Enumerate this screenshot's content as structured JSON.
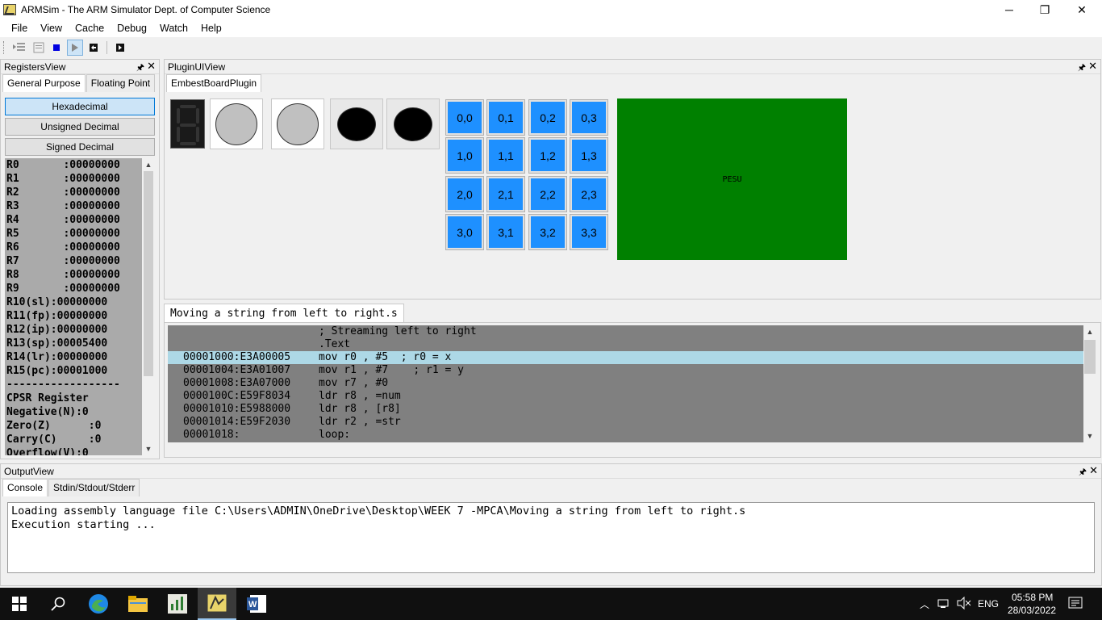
{
  "window": {
    "title": "ARMSim - The ARM Simulator Dept. of Computer Science",
    "minimize": "─",
    "restore": "❐",
    "close": "✕"
  },
  "menu": [
    "File",
    "View",
    "Cache",
    "Debug",
    "Watch",
    "Help"
  ],
  "registers_view": {
    "title": "RegistersView",
    "tabs": [
      "General Purpose",
      "Floating Point"
    ],
    "formats": [
      "Hexadecimal",
      "Unsigned Decimal",
      "Signed Decimal"
    ],
    "selected_format": "Hexadecimal",
    "lines": [
      "R0       :00000000",
      "R1       :00000000",
      "R2       :00000000",
      "R3       :00000000",
      "R4       :00000000",
      "R5       :00000000",
      "R6       :00000000",
      "R7       :00000000",
      "R8       :00000000",
      "R9       :00000000",
      "R10(sl):00000000",
      "R11(fp):00000000",
      "R12(ip):00000000",
      "R13(sp):00005400",
      "R14(lr):00000000",
      "R15(pc):00001000",
      "------------------",
      "CPSR Register",
      "Negative(N):0",
      "Zero(Z)      :0",
      "Carry(C)     :0",
      "Overflow(V):0"
    ]
  },
  "plugin_view": {
    "title": "PluginUIView",
    "tab": "EmbestBoardPlugin",
    "leds": [
      {
        "state": "off",
        "color": "#c0c0c0"
      },
      {
        "state": "off",
        "color": "#c0c0c0"
      },
      {
        "state": "on",
        "color": "#000000"
      },
      {
        "state": "on",
        "color": "#000000"
      }
    ],
    "keypad": [
      [
        "0,0",
        "0,1",
        "0,2",
        "0,3"
      ],
      [
        "1,0",
        "1,1",
        "1,2",
        "1,3"
      ],
      [
        "2,0",
        "2,1",
        "2,2",
        "2,3"
      ],
      [
        "3,0",
        "3,1",
        "3,2",
        "3,3"
      ]
    ],
    "keypad_color": "#1e90ff",
    "lcd_text": "PESU",
    "lcd_color": "#008000"
  },
  "code_view": {
    "tab": "Moving a string from left to right.s",
    "lines": [
      {
        "addr": "",
        "src": "; Streaming left to right",
        "highlight": false
      },
      {
        "addr": "",
        "src": ".Text",
        "highlight": false
      },
      {
        "addr": "00001000:E3A00005",
        "src": "mov r0 , #5  ; r0 = x",
        "highlight": true
      },
      {
        "addr": "00001004:E3A01007",
        "src": "mov r1 , #7    ; r1 = y",
        "highlight": false
      },
      {
        "addr": "00001008:E3A07000",
        "src": "mov r7 , #0",
        "highlight": false
      },
      {
        "addr": "0000100C:E59F8034",
        "src": "ldr r8 , =num",
        "highlight": false
      },
      {
        "addr": "00001010:E5988000",
        "src": "ldr r8 , [r8]",
        "highlight": false
      },
      {
        "addr": "00001014:E59F2030",
        "src": "ldr r2 , =str",
        "highlight": false
      },
      {
        "addr": "00001018:",
        "src": "loop:",
        "highlight": false
      }
    ],
    "highlight_color": "#add8e6",
    "background_color": "#808080"
  },
  "output_view": {
    "title": "OutputView",
    "tabs": [
      "Console",
      "Stdin/Stdout/Stderr"
    ],
    "console_lines": [
      "Loading assembly language file C:\\Users\\ADMIN\\OneDrive\\Desktop\\WEEK 7 -MPCA\\Moving a string from left to right.s",
      "Execution starting ..."
    ]
  },
  "taskbar": {
    "language": "ENG",
    "time": "05:58 PM",
    "date": "28/03/2022",
    "apps": [
      "start-icon",
      "search-icon",
      "edge-icon",
      "file-explorer-icon",
      "charts-app-icon",
      "armsim-icon",
      "word-icon"
    ]
  }
}
